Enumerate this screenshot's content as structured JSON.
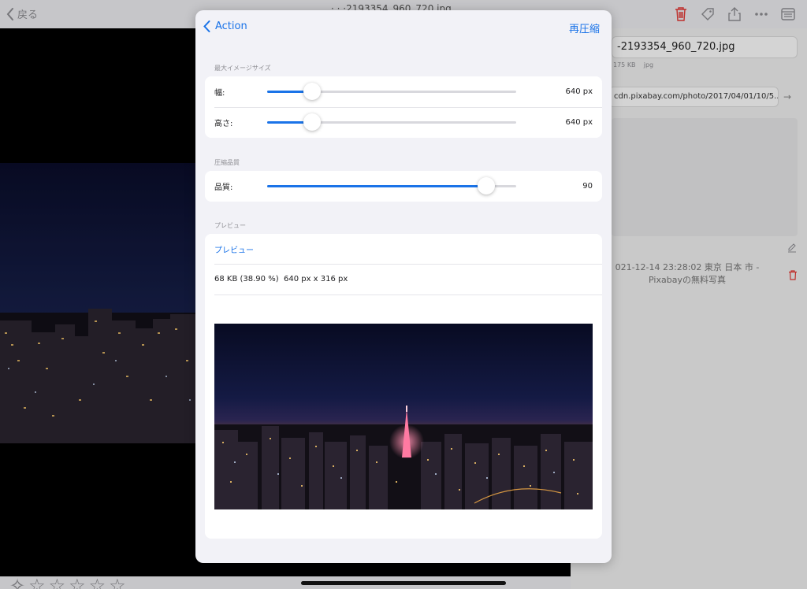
{
  "background_app": {
    "back_label": "戻る",
    "title_peek": "· · ·2193354_960_720.jpg",
    "filename": "-2193354_960_720.jpg",
    "file_size": "175 KB",
    "file_type": "jpg",
    "url": "cdn.pixabay.com/photo/2017/04/01/10/5...",
    "history_entry": "021-12-14 23:28:02 東京 日本 市 - Pixabayの無料写真",
    "rating_stars": 0,
    "icons": {
      "back": "chevron-left-icon",
      "delete": "trash-icon",
      "tag": "tag-icon",
      "share": "share-icon",
      "more": "ellipsis-icon",
      "reader": "reader-icon",
      "url_go": "arrow-right-icon",
      "edit": "edit-icon",
      "history_delete": "trash-icon"
    }
  },
  "modal": {
    "back_label": "Action",
    "action_label": "再圧縮",
    "max_size_section": "最大イメージサイズ",
    "width_row": {
      "label": "幅:",
      "value": "640 px",
      "slider_fraction": 0.18
    },
    "height_row": {
      "label": "高さ:",
      "value": "640 px",
      "slider_fraction": 0.18
    },
    "quality_section": "圧縮品質",
    "quality_row": {
      "label": "品質:",
      "value": "90",
      "slider_fraction": 0.88
    },
    "preview_section": "プレビュー",
    "preview_link": "プレビュー",
    "preview_info": "68 KB (38.90 %)  640 px x 316 px"
  },
  "colors": {
    "accent": "#1a73e8",
    "destructive": "#e53935",
    "modal_background": "#f2f2f7"
  }
}
